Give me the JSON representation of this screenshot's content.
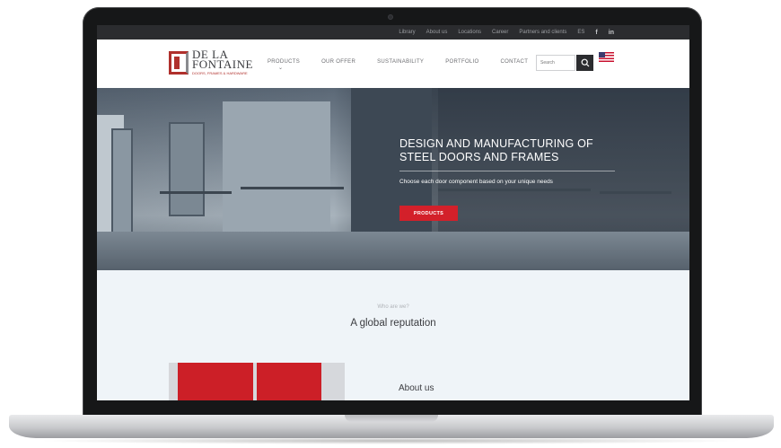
{
  "topbar": {
    "links": [
      "Library",
      "About us",
      "Locations",
      "Career",
      "Partners and clients",
      "ES"
    ],
    "social": [
      "f",
      "in"
    ]
  },
  "logo": {
    "line1": "DE LA",
    "line2": "FONTAINE",
    "tagline": "DOORS, FRAMES & HARDWARE"
  },
  "nav": [
    "PRODUCTS",
    "OUR OFFER",
    "SUSTAINABILITY",
    "PORTFOLIO",
    "CONTACT"
  ],
  "search": {
    "placeholder": "Search"
  },
  "language": {
    "flag": "us-flag"
  },
  "hero": {
    "title_line1": "DESIGN AND MANUFACTURING OF",
    "title_line2": "STEEL DOORS AND FRAMES",
    "subtitle": "Choose each door component based on your unique needs",
    "button": "PRODUCTS"
  },
  "about": {
    "eyebrow": "Who are we?",
    "heading": "A global reputation",
    "section_title": "About us"
  },
  "colors": {
    "accent": "#d3202a",
    "topbar": "#2b2c2f",
    "section_bg": "#eff4f8"
  }
}
